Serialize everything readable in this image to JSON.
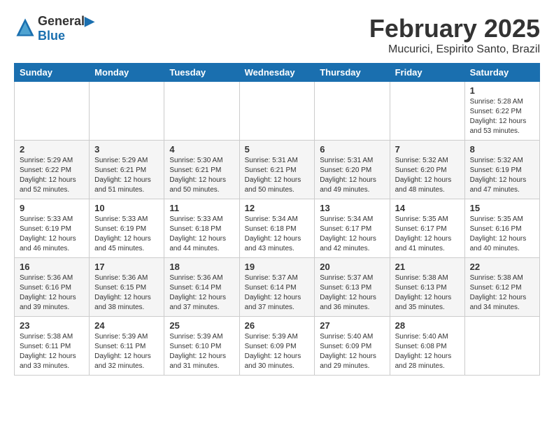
{
  "logo": {
    "line1": "General",
    "line2": "Blue"
  },
  "title": "February 2025",
  "location": "Mucurici, Espirito Santo, Brazil",
  "days_of_week": [
    "Sunday",
    "Monday",
    "Tuesday",
    "Wednesday",
    "Thursday",
    "Friday",
    "Saturday"
  ],
  "weeks": [
    [
      {
        "day": "",
        "info": ""
      },
      {
        "day": "",
        "info": ""
      },
      {
        "day": "",
        "info": ""
      },
      {
        "day": "",
        "info": ""
      },
      {
        "day": "",
        "info": ""
      },
      {
        "day": "",
        "info": ""
      },
      {
        "day": "1",
        "info": "Sunrise: 5:28 AM\nSunset: 6:22 PM\nDaylight: 12 hours\nand 53 minutes."
      }
    ],
    [
      {
        "day": "2",
        "info": "Sunrise: 5:29 AM\nSunset: 6:22 PM\nDaylight: 12 hours\nand 52 minutes."
      },
      {
        "day": "3",
        "info": "Sunrise: 5:29 AM\nSunset: 6:21 PM\nDaylight: 12 hours\nand 51 minutes."
      },
      {
        "day": "4",
        "info": "Sunrise: 5:30 AM\nSunset: 6:21 PM\nDaylight: 12 hours\nand 50 minutes."
      },
      {
        "day": "5",
        "info": "Sunrise: 5:31 AM\nSunset: 6:21 PM\nDaylight: 12 hours\nand 50 minutes."
      },
      {
        "day": "6",
        "info": "Sunrise: 5:31 AM\nSunset: 6:20 PM\nDaylight: 12 hours\nand 49 minutes."
      },
      {
        "day": "7",
        "info": "Sunrise: 5:32 AM\nSunset: 6:20 PM\nDaylight: 12 hours\nand 48 minutes."
      },
      {
        "day": "8",
        "info": "Sunrise: 5:32 AM\nSunset: 6:19 PM\nDaylight: 12 hours\nand 47 minutes."
      }
    ],
    [
      {
        "day": "9",
        "info": "Sunrise: 5:33 AM\nSunset: 6:19 PM\nDaylight: 12 hours\nand 46 minutes."
      },
      {
        "day": "10",
        "info": "Sunrise: 5:33 AM\nSunset: 6:19 PM\nDaylight: 12 hours\nand 45 minutes."
      },
      {
        "day": "11",
        "info": "Sunrise: 5:33 AM\nSunset: 6:18 PM\nDaylight: 12 hours\nand 44 minutes."
      },
      {
        "day": "12",
        "info": "Sunrise: 5:34 AM\nSunset: 6:18 PM\nDaylight: 12 hours\nand 43 minutes."
      },
      {
        "day": "13",
        "info": "Sunrise: 5:34 AM\nSunset: 6:17 PM\nDaylight: 12 hours\nand 42 minutes."
      },
      {
        "day": "14",
        "info": "Sunrise: 5:35 AM\nSunset: 6:17 PM\nDaylight: 12 hours\nand 41 minutes."
      },
      {
        "day": "15",
        "info": "Sunrise: 5:35 AM\nSunset: 6:16 PM\nDaylight: 12 hours\nand 40 minutes."
      }
    ],
    [
      {
        "day": "16",
        "info": "Sunrise: 5:36 AM\nSunset: 6:16 PM\nDaylight: 12 hours\nand 39 minutes."
      },
      {
        "day": "17",
        "info": "Sunrise: 5:36 AM\nSunset: 6:15 PM\nDaylight: 12 hours\nand 38 minutes."
      },
      {
        "day": "18",
        "info": "Sunrise: 5:36 AM\nSunset: 6:14 PM\nDaylight: 12 hours\nand 37 minutes."
      },
      {
        "day": "19",
        "info": "Sunrise: 5:37 AM\nSunset: 6:14 PM\nDaylight: 12 hours\nand 37 minutes."
      },
      {
        "day": "20",
        "info": "Sunrise: 5:37 AM\nSunset: 6:13 PM\nDaylight: 12 hours\nand 36 minutes."
      },
      {
        "day": "21",
        "info": "Sunrise: 5:38 AM\nSunset: 6:13 PM\nDaylight: 12 hours\nand 35 minutes."
      },
      {
        "day": "22",
        "info": "Sunrise: 5:38 AM\nSunset: 6:12 PM\nDaylight: 12 hours\nand 34 minutes."
      }
    ],
    [
      {
        "day": "23",
        "info": "Sunrise: 5:38 AM\nSunset: 6:11 PM\nDaylight: 12 hours\nand 33 minutes."
      },
      {
        "day": "24",
        "info": "Sunrise: 5:39 AM\nSunset: 6:11 PM\nDaylight: 12 hours\nand 32 minutes."
      },
      {
        "day": "25",
        "info": "Sunrise: 5:39 AM\nSunset: 6:10 PM\nDaylight: 12 hours\nand 31 minutes."
      },
      {
        "day": "26",
        "info": "Sunrise: 5:39 AM\nSunset: 6:09 PM\nDaylight: 12 hours\nand 30 minutes."
      },
      {
        "day": "27",
        "info": "Sunrise: 5:40 AM\nSunset: 6:09 PM\nDaylight: 12 hours\nand 29 minutes."
      },
      {
        "day": "28",
        "info": "Sunrise: 5:40 AM\nSunset: 6:08 PM\nDaylight: 12 hours\nand 28 minutes."
      },
      {
        "day": "",
        "info": ""
      }
    ]
  ]
}
